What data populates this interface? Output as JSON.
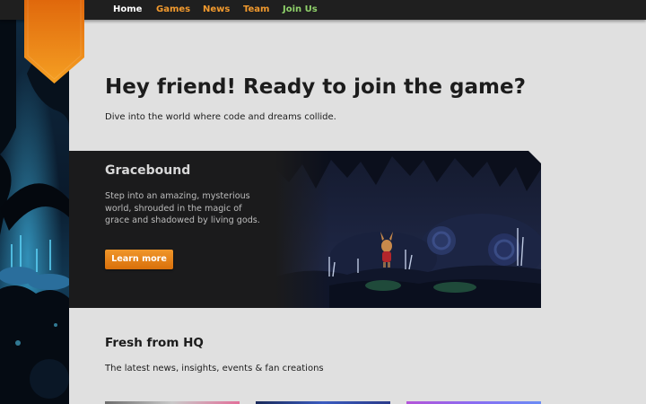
{
  "nav": {
    "items": [
      {
        "label": "Home",
        "color": "#ffffff"
      },
      {
        "label": "Games",
        "color": "#f29a2e"
      },
      {
        "label": "News",
        "color": "#f29a2e"
      },
      {
        "label": "Team",
        "color": "#f29a2e"
      },
      {
        "label": "Join Us",
        "color": "#8fd16a"
      }
    ]
  },
  "hero": {
    "title": "Hey friend! Ready to join the game?",
    "subtitle": "Dive into the world where code and dreams collide."
  },
  "feature": {
    "title": "Gracebound",
    "description": "Step into an amazing, mysterious world, shrouded in the magic of grace and shadowed by living gods.",
    "button_label": "Learn more"
  },
  "news": {
    "title": "Fresh from HQ",
    "subtitle": "The latest news, insights, events & fan creations",
    "thumbnails": [
      "news-thumb-1",
      "news-thumb-2",
      "news-thumb-3"
    ]
  },
  "colors": {
    "accent": "#f08a1c",
    "page_background": "#e0e0e0",
    "topbar": "#1f1f1f",
    "card": "#1b1b1c"
  }
}
